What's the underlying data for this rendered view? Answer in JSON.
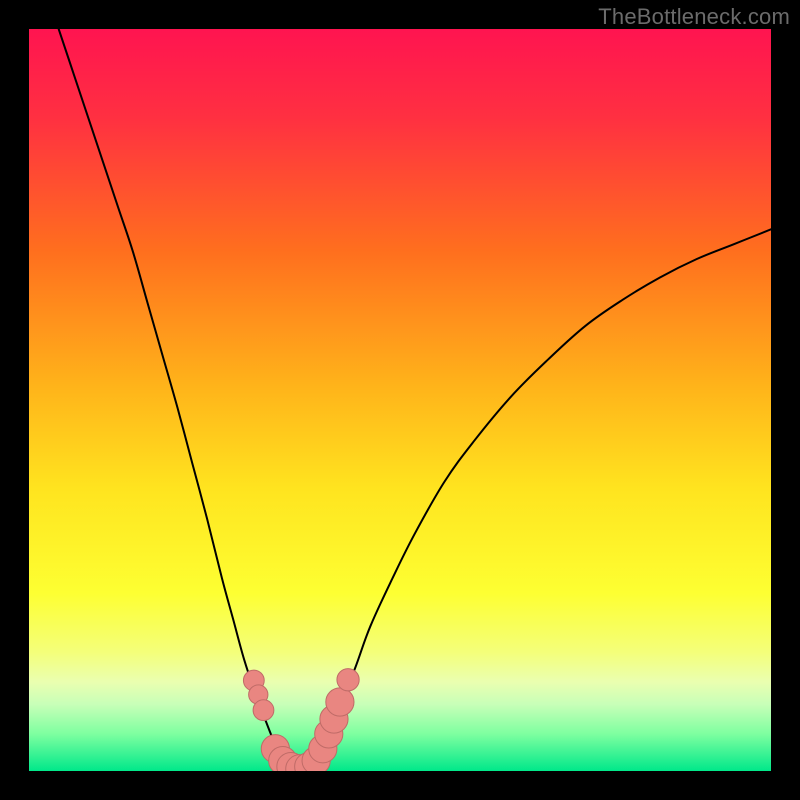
{
  "watermark": "TheBottleneck.com",
  "chart_data": {
    "type": "line",
    "title": "",
    "xlabel": "",
    "ylabel": "",
    "xlim": [
      0,
      100
    ],
    "ylim": [
      0,
      100
    ],
    "grid": false,
    "legend": false,
    "background": {
      "type": "vertical-gradient",
      "stops": [
        {
          "offset": 0.0,
          "color": "#ff1450"
        },
        {
          "offset": 0.12,
          "color": "#ff3041"
        },
        {
          "offset": 0.3,
          "color": "#ff6f1e"
        },
        {
          "offset": 0.48,
          "color": "#ffb31a"
        },
        {
          "offset": 0.62,
          "color": "#ffe41f"
        },
        {
          "offset": 0.76,
          "color": "#fdff32"
        },
        {
          "offset": 0.84,
          "color": "#f4ff7a"
        },
        {
          "offset": 0.88,
          "color": "#eaffb0"
        },
        {
          "offset": 0.91,
          "color": "#c8ffb8"
        },
        {
          "offset": 0.95,
          "color": "#7effa0"
        },
        {
          "offset": 1.0,
          "color": "#00e88a"
        }
      ]
    },
    "series": [
      {
        "name": "bottleneck-left",
        "stroke": "#000000",
        "x": [
          4,
          6,
          8,
          10,
          12,
          14,
          16,
          18,
          20,
          22,
          24,
          26,
          27.5,
          29,
          30.5,
          32,
          33,
          34,
          35
        ],
        "y": [
          100,
          94,
          88,
          82,
          76,
          70,
          63,
          56,
          49,
          41.5,
          34,
          26,
          20.5,
          15,
          10.5,
          6.5,
          4,
          2,
          0.5
        ]
      },
      {
        "name": "bottleneck-right",
        "stroke": "#000000",
        "x": [
          38,
          39,
          40.5,
          42,
          44,
          46,
          49,
          52,
          56,
          60,
          65,
          70,
          75,
          80,
          85,
          90,
          95,
          100
        ],
        "y": [
          0.5,
          2,
          5,
          9,
          14,
          19.5,
          26,
          32,
          39,
          44.5,
          50.5,
          55.5,
          60,
          63.5,
          66.5,
          69,
          71,
          73
        ]
      }
    ],
    "markers": {
      "name": "highlight",
      "color": "#e98681",
      "stroke": "#bf6b67",
      "points": [
        {
          "x": 30.3,
          "y": 12.2,
          "r": 1.4
        },
        {
          "x": 30.9,
          "y": 10.3,
          "r": 1.3
        },
        {
          "x": 31.6,
          "y": 8.2,
          "r": 1.4
        },
        {
          "x": 33.2,
          "y": 3.0,
          "r": 1.9
        },
        {
          "x": 34.2,
          "y": 1.4,
          "r": 1.9
        },
        {
          "x": 35.3,
          "y": 0.6,
          "r": 1.9
        },
        {
          "x": 36.5,
          "y": 0.3,
          "r": 1.9
        },
        {
          "x": 37.7,
          "y": 0.6,
          "r": 1.9
        },
        {
          "x": 38.7,
          "y": 1.4,
          "r": 1.9
        },
        {
          "x": 39.6,
          "y": 3.0,
          "r": 1.9
        },
        {
          "x": 40.4,
          "y": 5.0,
          "r": 1.9
        },
        {
          "x": 41.1,
          "y": 7.0,
          "r": 1.9
        },
        {
          "x": 41.9,
          "y": 9.3,
          "r": 1.9
        },
        {
          "x": 43.0,
          "y": 12.3,
          "r": 1.5
        }
      ]
    }
  }
}
